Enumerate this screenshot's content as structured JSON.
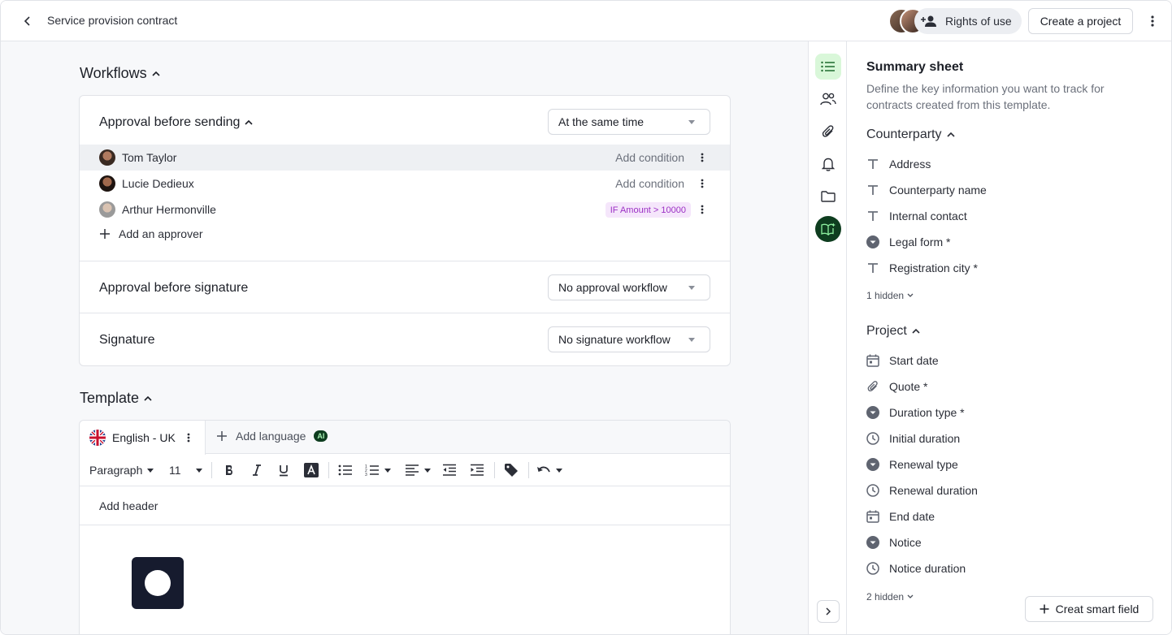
{
  "header": {
    "title": "Service provision contract",
    "rights_label": "Rights of use",
    "create_project_label": "Create a project"
  },
  "workflows": {
    "title": "Workflows",
    "approval_before_sending": {
      "title": "Approval before sending",
      "mode": "At the same time",
      "approvers": [
        {
          "name": "Tom Taylor",
          "action": "Add condition"
        },
        {
          "name": "Lucie Dedieux",
          "action": "Add condition"
        },
        {
          "name": "Arthur Hermonville",
          "condition": "IF Amount > 10000"
        }
      ],
      "add_label": "Add an approver"
    },
    "approval_before_signature": {
      "title": "Approval before signature",
      "value": "No approval workflow"
    },
    "signature": {
      "title": "Signature",
      "value": "No signature workflow"
    }
  },
  "template": {
    "title": "Template",
    "language": "English - UK",
    "add_language_label": "Add language",
    "ai_badge": "AI",
    "toolbar": {
      "style": "Paragraph",
      "font_size": "11"
    },
    "header_placeholder": "Add header"
  },
  "summary": {
    "title": "Summary sheet",
    "description": "Define the key information you want to track for contracts created from this template.",
    "groups": [
      {
        "name": "Counterparty",
        "fields": [
          {
            "label": "Address",
            "icon": "text-icon"
          },
          {
            "label": "Counterparty name",
            "icon": "text-icon"
          },
          {
            "label": "Internal contact",
            "icon": "text-icon"
          },
          {
            "label": "Legal form *",
            "icon": "dropdown-icon"
          },
          {
            "label": "Registration city *",
            "icon": "text-icon"
          }
        ],
        "hidden_label": "1 hidden"
      },
      {
        "name": "Project",
        "fields": [
          {
            "label": "Start date",
            "icon": "calendar-icon"
          },
          {
            "label": "Quote *",
            "icon": "paperclip-icon"
          },
          {
            "label": "Duration type *",
            "icon": "dropdown-icon"
          },
          {
            "label": "Initial duration",
            "icon": "clock-icon"
          },
          {
            "label": "Renewal type",
            "icon": "dropdown-icon"
          },
          {
            "label": "Renewal duration",
            "icon": "clock-icon"
          },
          {
            "label": "End date",
            "icon": "calendar-icon"
          },
          {
            "label": "Notice",
            "icon": "dropdown-icon"
          },
          {
            "label": "Notice duration",
            "icon": "clock-icon"
          }
        ],
        "hidden_label": "2 hidden"
      }
    ],
    "create_field_label": "Creat smart field"
  },
  "colors": {
    "accent_green": "#d9f7d9",
    "ai_dark": "#0e3d1f",
    "condition_purple": "#9b2fc4"
  }
}
